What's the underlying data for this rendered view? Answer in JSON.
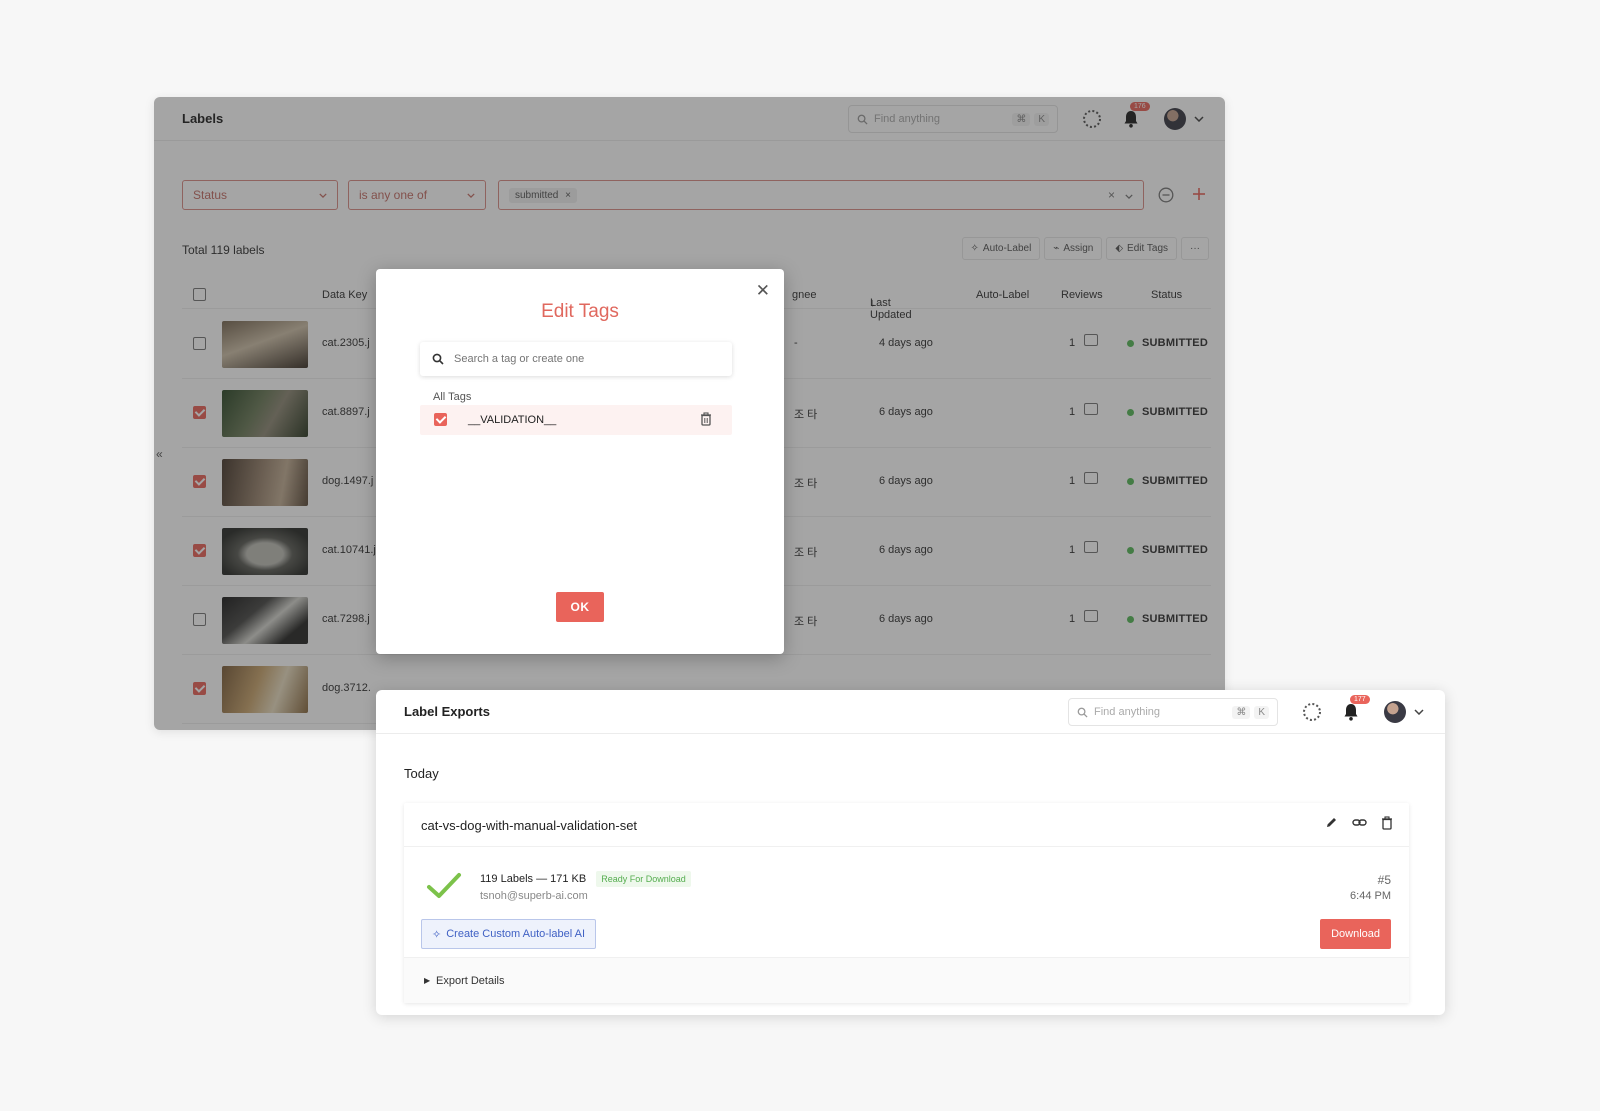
{
  "labels_window": {
    "title": "Labels",
    "search_placeholder": "Find anything",
    "kbd_cmd": "⌘",
    "kbd_k": "K",
    "notification_count": "176",
    "filter": {
      "field": "Status",
      "operator": "is any one of",
      "value_chip": "submitted"
    },
    "total": "Total 119 labels",
    "toolbar": {
      "auto_label": "Auto-Label",
      "assign": "Assign",
      "edit_tags": "Edit Tags",
      "more": "···"
    },
    "columns": {
      "data_key": "Data Key",
      "assignee": "gnee",
      "last_updated": "Last Updated",
      "auto_label": "Auto-Label",
      "reviews": "Reviews",
      "status": "Status"
    },
    "rows": [
      {
        "key": "cat.2305.j",
        "assignee": "-",
        "updated": "4 days ago",
        "reviews": "1",
        "status": "SUBMITTED",
        "checked": false
      },
      {
        "key": "cat.8897.j",
        "assignee": "조 타",
        "updated": "6 days ago",
        "reviews": "1",
        "status": "SUBMITTED",
        "checked": true
      },
      {
        "key": "dog.1497.j",
        "assignee": "조 타",
        "updated": "6 days ago",
        "reviews": "1",
        "status": "SUBMITTED",
        "checked": true
      },
      {
        "key": "cat.10741.j",
        "assignee": "조 타",
        "updated": "6 days ago",
        "reviews": "1",
        "status": "SUBMITTED",
        "checked": true
      },
      {
        "key": "cat.7298.j",
        "assignee": "조 타",
        "updated": "6 days ago",
        "reviews": "1",
        "status": "SUBMITTED",
        "checked": false
      },
      {
        "key": "dog.3712.",
        "assignee": "",
        "updated": "",
        "reviews": "",
        "status": "",
        "checked": true
      }
    ]
  },
  "edit_tags_modal": {
    "title": "Edit Tags",
    "search_placeholder": "Search a tag or create one",
    "section_label": "All Tags",
    "tags": [
      {
        "name": "__VALIDATION__",
        "checked": true
      }
    ],
    "ok_label": "OK"
  },
  "exports_window": {
    "title": "Label Exports",
    "search_placeholder": "Find anything",
    "kbd_cmd": "⌘",
    "kbd_k": "K",
    "notification_count": "177",
    "section": "Today",
    "export": {
      "name": "cat-vs-dog-with-manual-validation-set",
      "summary": "119 Labels — 171 KB",
      "ready_badge": "Ready For Download",
      "email": "tsnoh@superb-ai.com",
      "number": "#5",
      "time": "6:44 PM",
      "create_button": "Create Custom Auto-label AI",
      "download_button": "Download",
      "details_toggle": "Export Details"
    }
  },
  "colors": {
    "accent": "#e9645b",
    "success": "#58b85a",
    "link_blue": "#4061c4"
  }
}
